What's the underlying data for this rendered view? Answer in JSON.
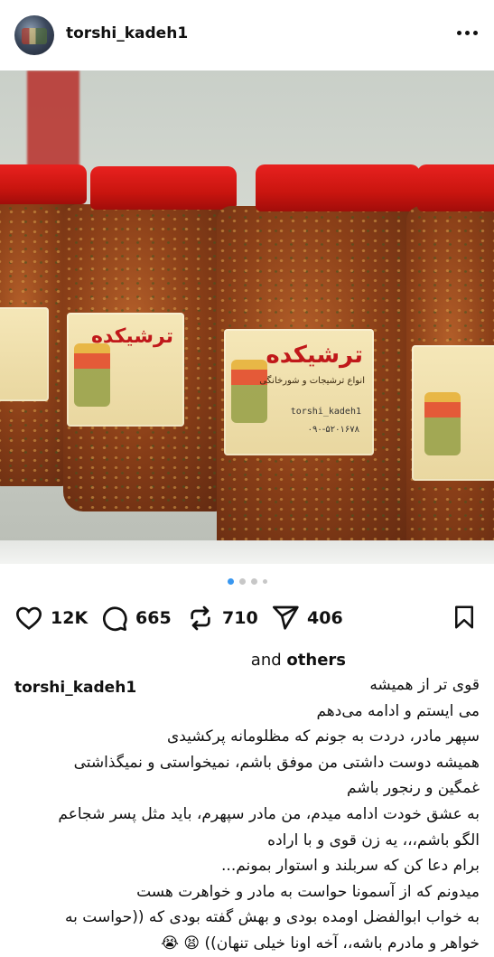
{
  "post": {
    "username": "torshi_kadeh1",
    "more_icon": "more-horizontal-icon",
    "image": {
      "jar_label_title": "ترشیکده",
      "jar_label_subtitle": "انواع ترشیجات و شورخانگی",
      "jar_label_handle": "torshi_kadeh1",
      "jar_label_phone": "۰۹۰-۵۲۰۱۶۷۸"
    },
    "carousel": {
      "total": 4,
      "active_index": 0
    },
    "actions": {
      "like": {
        "icon": "heart-icon",
        "count": "12K"
      },
      "comment": {
        "icon": "comment-icon",
        "count": "665"
      },
      "repost": {
        "icon": "repost-icon",
        "count": "710"
      },
      "share": {
        "icon": "send-icon",
        "count": "406"
      },
      "save": {
        "icon": "bookmark-icon"
      }
    },
    "liked_by": {
      "prefix": "and",
      "suffix": "others"
    },
    "caption": {
      "username": "torshi_kadeh1",
      "lines": [
        "قوی تر از همیشه",
        "می ایستم و ادامه می‌دهم",
        "سپهر مادر، دردت به جونم که مظلومانه پرکشیدی",
        "همیشه دوست داشتی من موفق باشم، نمیخواستی و نمیگذاشتی",
        "غمگین و رنجور باشم",
        "به عشق خودت ادامه میدم، من مادر سپهرم، باید مثل پسر شجاعم",
        "الگو باشم،،، یه زن قوی و با اراده",
        "برام دعا کن که سربلند و استوار بمونم...",
        "میدونم که از آسمونا حواست به مادر و خواهرت هست",
        "به خواب ابوالفضل اومده بودی و بهش گفته  بودی که ((حواست به",
        "خواهر و مادرم باشه،، آخه اونا خیلی تنهان)) 😫 😭"
      ]
    }
  }
}
